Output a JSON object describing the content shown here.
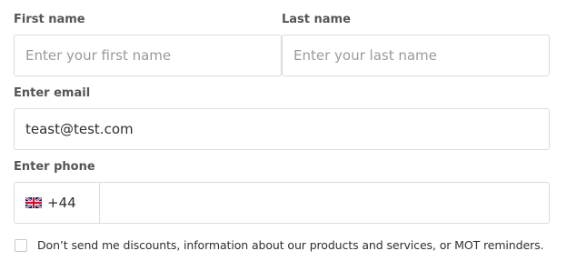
{
  "form": {
    "first_name": {
      "label": "First name",
      "value": "",
      "placeholder": "Enter your first name"
    },
    "last_name": {
      "label": "Last name",
      "value": "",
      "placeholder": "Enter your last name"
    },
    "email": {
      "label": "Enter email",
      "value": "teast@test.com",
      "placeholder": ""
    },
    "phone": {
      "label": "Enter phone",
      "country_icon": "uk-flag-icon",
      "country_code": "+44",
      "value": ""
    },
    "marketing_opt_out": {
      "checked": false,
      "label": "Don’t send me discounts, information about our products and services, or MOT reminders."
    }
  },
  "colors": {
    "border": "#dcdcdc",
    "label": "#555555",
    "text": "#2f2f2f",
    "placeholder": "#9a9a9a"
  }
}
